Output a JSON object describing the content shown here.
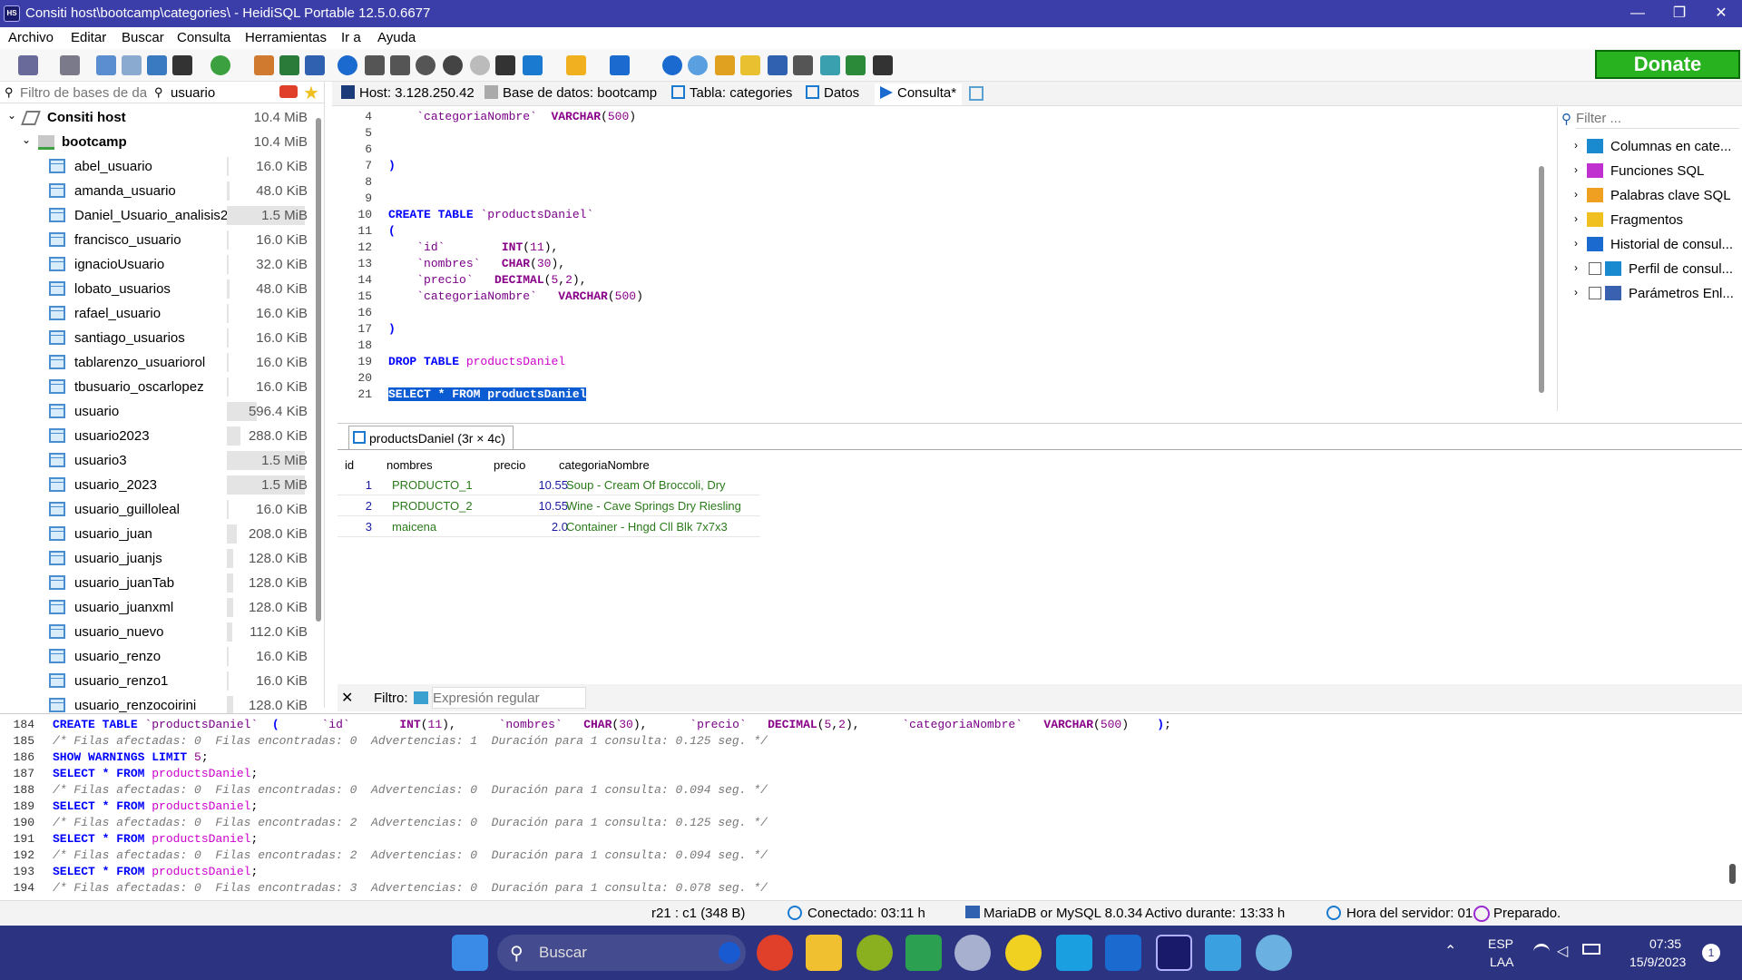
{
  "window": {
    "title": "Consiti host\\bootcamp\\categories\\ - HeidiSQL Portable 12.5.0.6677",
    "app_icon_text": "HS",
    "minimize": "—",
    "maximize": "❐",
    "close": "✕"
  },
  "menu": [
    "Archivo",
    "Editar",
    "Buscar",
    "Consulta",
    "Herramientas",
    "Ir a",
    "Ayuda"
  ],
  "donate_label": "Donate",
  "db_filter": {
    "placeholder": "Filtro de bases de da",
    "table_filter_value": "usuario"
  },
  "tabs": [
    {
      "label": "Host: 3.128.250.42",
      "icon": "host-icon"
    },
    {
      "label": "Base de datos: bootcamp",
      "icon": "database-icon"
    },
    {
      "label": "Tabla: categories",
      "icon": "table-icon"
    },
    {
      "label": "Datos",
      "icon": "grid-icon"
    },
    {
      "label": "Consulta*",
      "icon": "play-icon"
    }
  ],
  "tree": {
    "host": {
      "label": "Consiti host",
      "size": "10.4 MiB"
    },
    "database": {
      "label": "bootcamp",
      "size": "10.4 MiB"
    },
    "tables": [
      {
        "name": "abel_usuario",
        "size": "16.0 KiB",
        "fill": 0.01
      },
      {
        "name": "amanda_usuario",
        "size": "48.0 KiB",
        "fill": 0.03
      },
      {
        "name": "Daniel_Usuario_analisis2",
        "size": "1.5 MiB",
        "fill": 1.0
      },
      {
        "name": "francisco_usuario",
        "size": "16.0 KiB",
        "fill": 0.01
      },
      {
        "name": "ignacioUsuario",
        "size": "32.0 KiB",
        "fill": 0.02
      },
      {
        "name": "lobato_usuarios",
        "size": "48.0 KiB",
        "fill": 0.03
      },
      {
        "name": "rafael_usuario",
        "size": "16.0 KiB",
        "fill": 0.01
      },
      {
        "name": "santiago_usuarios",
        "size": "16.0 KiB",
        "fill": 0.01
      },
      {
        "name": "tablarenzo_usuariorol",
        "size": "16.0 KiB",
        "fill": 0.01
      },
      {
        "name": "tbusuario_oscarlopez",
        "size": "16.0 KiB",
        "fill": 0.01
      },
      {
        "name": "usuario",
        "size": "596.4 KiB",
        "fill": 0.38
      },
      {
        "name": "usuario2023",
        "size": "288.0 KiB",
        "fill": 0.18
      },
      {
        "name": "usuario3",
        "size": "1.5 MiB",
        "fill": 1.0
      },
      {
        "name": "usuario_2023",
        "size": "1.5 MiB",
        "fill": 1.0
      },
      {
        "name": "usuario_guilloleal",
        "size": "16.0 KiB",
        "fill": 0.01
      },
      {
        "name": "usuario_juan",
        "size": "208.0 KiB",
        "fill": 0.13
      },
      {
        "name": "usuario_juanjs",
        "size": "128.0 KiB",
        "fill": 0.08
      },
      {
        "name": "usuario_juanTab",
        "size": "128.0 KiB",
        "fill": 0.08
      },
      {
        "name": "usuario_juanxml",
        "size": "128.0 KiB",
        "fill": 0.08
      },
      {
        "name": "usuario_nuevo",
        "size": "112.0 KiB",
        "fill": 0.07
      },
      {
        "name": "usuario_renzo",
        "size": "16.0 KiB",
        "fill": 0.01
      },
      {
        "name": "usuario_renzo1",
        "size": "16.0 KiB",
        "fill": 0.01
      },
      {
        "name": "usuario_renzocoirini",
        "size": "128.0 KiB",
        "fill": 0.08
      }
    ]
  },
  "editor": {
    "lines": [
      {
        "n": "4",
        "html": "    <span class=\"str\">`categoriaNombre`</span>  <span class=\"fn\">VARCHAR</span>(<span class=\"num\">500</span>)"
      },
      {
        "n": "5",
        "html": ""
      },
      {
        "n": "6",
        "html": ""
      },
      {
        "n": "7",
        "html": "<span class=\"kw\">)</span>"
      },
      {
        "n": "8",
        "html": ""
      },
      {
        "n": "9",
        "html": ""
      },
      {
        "n": "10",
        "html": "<span class=\"kw\">CREATE TABLE</span> <span class=\"str\">`productsDaniel`</span>"
      },
      {
        "n": "11",
        "html": "<span class=\"kw\">(</span>"
      },
      {
        "n": "12",
        "html": "    <span class=\"str\">`id`</span>        <span class=\"fn\">INT</span>(<span class=\"num\">11</span>),"
      },
      {
        "n": "13",
        "html": "    <span class=\"str\">`nombres`</span>   <span class=\"fn\">CHAR</span>(<span class=\"num\">30</span>),"
      },
      {
        "n": "14",
        "html": "    <span class=\"str\">`precio`</span>   <span class=\"fn\">DECIMAL</span>(<span class=\"num\">5</span>,<span class=\"num\">2</span>),"
      },
      {
        "n": "15",
        "html": "    <span class=\"str\">`categoriaNombre`</span>   <span class=\"fn\">VARCHAR</span>(<span class=\"num\">500</span>)"
      },
      {
        "n": "16",
        "html": ""
      },
      {
        "n": "17",
        "html": "<span class=\"kw\">)</span>"
      },
      {
        "n": "18",
        "html": ""
      },
      {
        "n": "19",
        "html": "<span class=\"kw\">DROP TABLE</span> <span class=\"tblname\">productsDaniel</span>"
      },
      {
        "n": "20",
        "html": ""
      },
      {
        "n": "21",
        "html": "<span style=\"background:#0b5bd3;color:#fff;font-weight:bold\">SELECT * FROM productsDaniel</span>"
      }
    ]
  },
  "right_panel": {
    "filter_placeholder": "Filter ...",
    "items": [
      {
        "label": "Columnas en cate...",
        "icon": "columns-icon"
      },
      {
        "label": "Funciones SQL",
        "icon": "lightning-icon"
      },
      {
        "label": "Palabras clave SQL",
        "icon": "key-icon"
      },
      {
        "label": "Fragmentos",
        "icon": "folder-icon"
      },
      {
        "label": "Historial de consul...",
        "icon": "clock-icon"
      },
      {
        "label": "Perfil de consul...",
        "icon": "chart-icon"
      },
      {
        "label": "Parámetros Enl...",
        "icon": "code-icon"
      }
    ]
  },
  "result": {
    "tab_label": "productsDaniel (3r × 4c)",
    "columns": [
      "id",
      "nombres",
      "precio",
      "categoriaNombre"
    ],
    "rows": [
      [
        "1",
        "PRODUCTO_1",
        "10.55",
        "Soup - Cream Of Broccoli, Dry"
      ],
      [
        "2",
        "PRODUCTO_2",
        "10.55",
        "Wine - Cave Springs Dry Riesling"
      ],
      [
        "3",
        "maicena",
        "2.0",
        "Container - Hngd Cll Blk 7x7x3"
      ]
    ]
  },
  "filter": {
    "close": "✕",
    "label": "Filtro:",
    "placeholder": "Expresión regular"
  },
  "log": [
    {
      "n": "184",
      "html": "<span class=\"kw\">CREATE TABLE</span> <span class=\"str\">`productsDaniel`</span>  <span class=\"kw\">(</span>      <span class=\"str\">`id`</span>       <span class=\"fn\">INT</span>(<span class=\"num\">11</span>),      <span class=\"str\">`nombres`</span>   <span class=\"fn\">CHAR</span>(<span class=\"num\">30</span>),      <span class=\"str\">`precio`</span>   <span class=\"fn\">DECIMAL</span>(<span class=\"num\">5</span>,<span class=\"num\">2</span>),      <span class=\"str\">`categoriaNombre`</span>   <span class=\"fn\">VARCHAR</span>(<span class=\"num\">500</span>)    <span class=\"kw\">)</span>;"
    },
    {
      "n": "185",
      "html": "<span class=\"cmt\">/* Filas afectadas: 0  Filas encontradas: 0  Advertencias: 1  Duración para 1 consulta: 0.125 seg. */</span>"
    },
    {
      "n": "186",
      "html": "<span class=\"kw\">SHOW WARNINGS LIMIT</span> <span class=\"num\">5</span>;"
    },
    {
      "n": "187",
      "html": "<span class=\"kw\">SELECT * FROM</span> <span class=\"tblname\">productsDaniel</span>;"
    },
    {
      "n": "188",
      "html": "<span class=\"cmt\">/* Filas afectadas: 0  Filas encontradas: 0  Advertencias: 0  Duración para 1 consulta: 0.094 seg. */</span>"
    },
    {
      "n": "189",
      "html": "<span class=\"kw\">SELECT * FROM</span> <span class=\"tblname\">productsDaniel</span>;"
    },
    {
      "n": "190",
      "html": "<span class=\"cmt\">/* Filas afectadas: 0  Filas encontradas: 2  Advertencias: 0  Duración para 1 consulta: 0.125 seg. */</span>"
    },
    {
      "n": "191",
      "html": "<span class=\"kw\">SELECT * FROM</span> <span class=\"tblname\">productsDaniel</span>;"
    },
    {
      "n": "192",
      "html": "<span class=\"cmt\">/* Filas afectadas: 0  Filas encontradas: 2  Advertencias: 0  Duración para 1 consulta: 0.094 seg. */</span>"
    },
    {
      "n": "193",
      "html": "<span class=\"kw\">SELECT * FROM</span> <span class=\"tblname\">productsDaniel</span>;"
    },
    {
      "n": "194",
      "html": "<span class=\"cmt\">/* Filas afectadas: 0  Filas encontradas: 3  Advertencias: 0  Duración para 1 consulta: 0.078 seg. */</span>"
    }
  ],
  "status": {
    "cursor": "r21 : c1 (348 B)",
    "connected": "Conectado: 03:11 h",
    "server": "MariaDB or MySQL 8.0.34",
    "uptime": "Activo durante: 13:33 h",
    "server_time": "Hora del servidor: 01",
    "state": "Preparado."
  },
  "taskbar": {
    "search_placeholder": "Buscar",
    "lang": "ESP",
    "lang2": "LAA",
    "time": "07:35",
    "date": "15/9/2023",
    "notif": "1"
  },
  "colors": {
    "titlebar": "#3b3ea8",
    "taskbar": "#2c3380",
    "donate": "#29b21f",
    "selection": "#0b5bd3"
  }
}
